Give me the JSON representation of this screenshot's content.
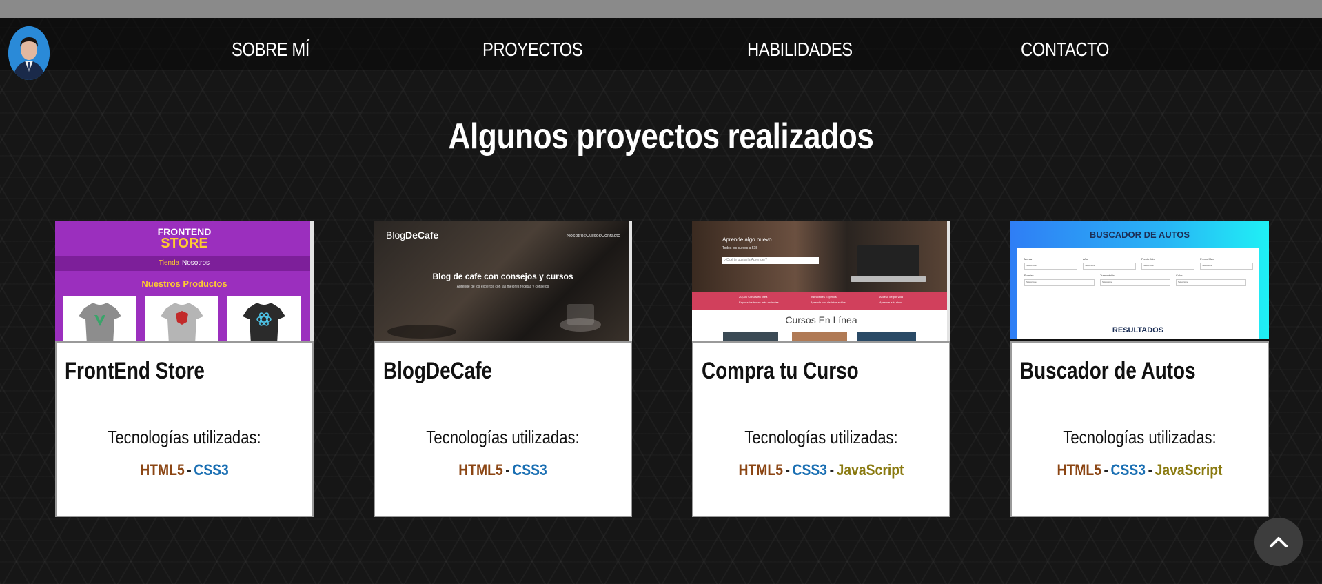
{
  "nav": {
    "links": [
      "SOBRE MÍ",
      "PROYECTOS",
      "HABILIDADES",
      "CONTACTO"
    ]
  },
  "section": {
    "title": "Algunos proyectos realizados"
  },
  "projects": [
    {
      "title": "FrontEnd Store",
      "tech_label": "Tecnologías utilizadas:",
      "techs": [
        "HTML5",
        "CSS3"
      ],
      "thumb": {
        "brand_line1": "FRONTEND",
        "brand_line2": "STORE",
        "nav": [
          "Tienda",
          "Nosotros"
        ],
        "heading": "Nuestros Productos"
      }
    },
    {
      "title": "BlogDeCafe",
      "tech_label": "Tecnologías utilizadas:",
      "techs": [
        "HTML5",
        "CSS3"
      ],
      "thumb": {
        "brand_a": "Blog",
        "brand_b": "DeCafe",
        "nav": [
          "Nosotros",
          "Cursos",
          "Contacto"
        ],
        "heading": "Blog de cafe con consejos y cursos",
        "subheading": "Aprende de los expertos con las mejores recetas y consejos"
      }
    },
    {
      "title": "Compra tu Curso",
      "tech_label": "Tecnologías utilizadas:",
      "techs": [
        "HTML5",
        "CSS3",
        "JavaScript"
      ],
      "thumb": {
        "hero_title": "Aprende algo nuevo",
        "hero_sub": "Todos los cursos a $15",
        "search_placeholder": "¿Qué te gustaría Aprender?",
        "features": [
          {
            "a": "20,000 Cursos en línea",
            "b": "Explora los temas más recientes"
          },
          {
            "a": "Instructores Expertos",
            "b": "Aprende con distintos estilos"
          },
          {
            "a": "Acceso de por vida",
            "b": "Aprende a tu ritmo"
          }
        ],
        "heading": "Cursos En Línea"
      }
    },
    {
      "title": "Buscador de Autos",
      "tech_label": "Tecnologías utilizadas:",
      "techs": [
        "HTML5",
        "CSS3",
        "JavaScript"
      ],
      "thumb": {
        "heading": "BUSCADOR DE AUTOS",
        "fields_row1": [
          "Marca",
          "Año",
          "Precio Min",
          "Precio Max"
        ],
        "fields_row2": [
          "Puertas",
          "Transmisión",
          "Color"
        ],
        "select_value": "Seleccione",
        "results": "RESULTADOS"
      }
    }
  ],
  "colors": {
    "html5": "#8b4513",
    "css3": "#1a6fb3",
    "javascript": "#8a7a10",
    "topstrip": "#8a8a8a"
  },
  "icons": {
    "to_top": "chevron-up-icon",
    "avatar": "profile-photo"
  }
}
